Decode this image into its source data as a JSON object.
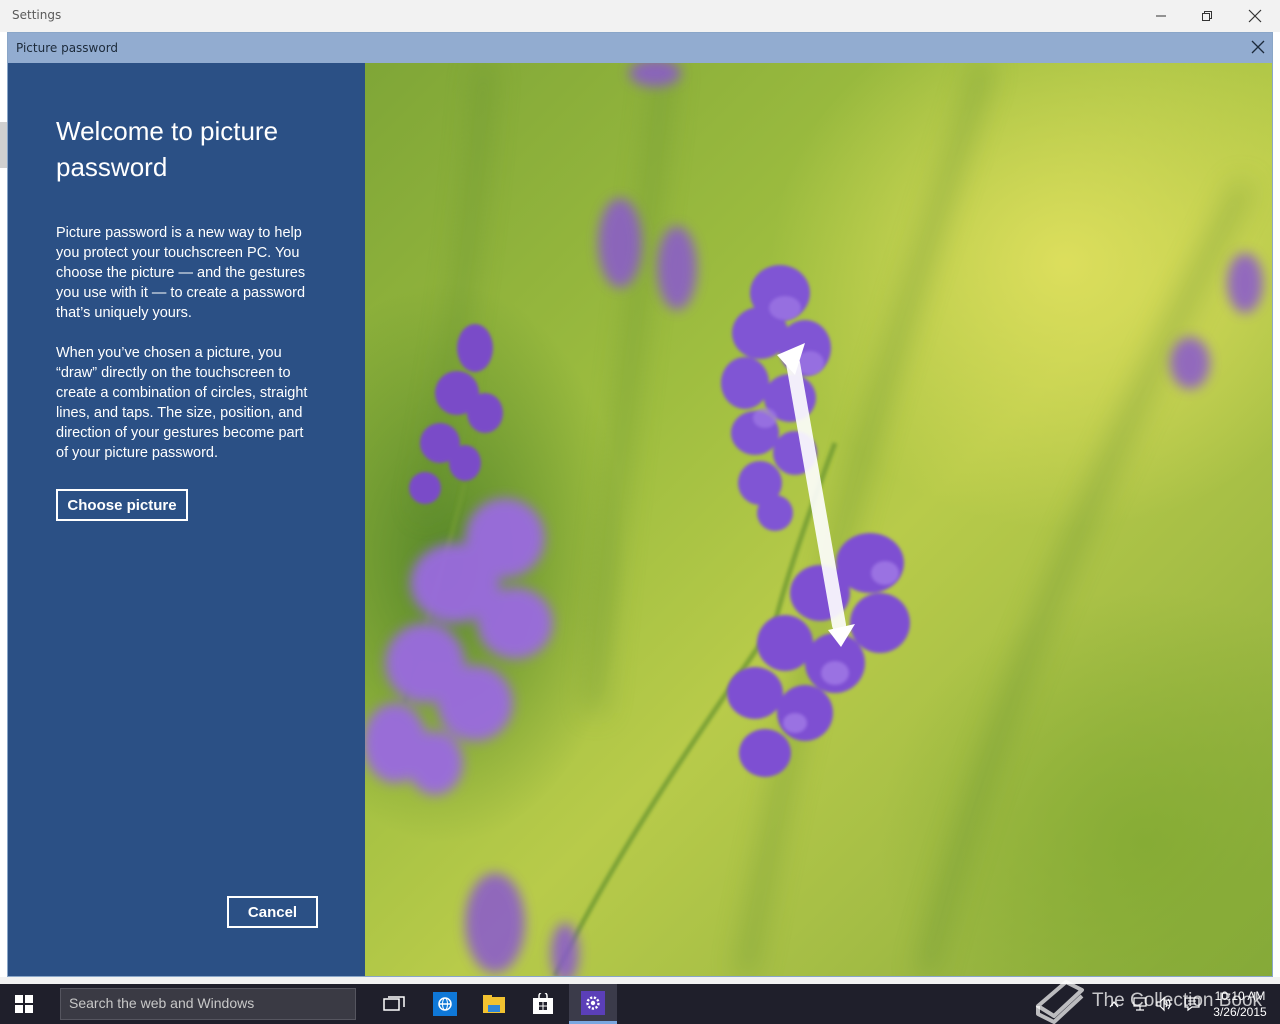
{
  "window": {
    "title": "Settings"
  },
  "dialog": {
    "title": "Picture password",
    "heading": "Welcome to picture password",
    "paragraph1": "Picture password is a new way to help you protect your touchscreen PC. You choose the picture — and the gestures you use with it — to create a password that’s uniquely yours.",
    "paragraph2": "When you’ve chosen a picture, you “draw” directly on the touchscreen to create a combination of circles, straight lines, and taps. The size, position, and direction of your gestures become part of your picture password.",
    "choose_label": "Choose picture",
    "cancel_label": "Cancel"
  },
  "taskbar": {
    "search_placeholder": "Search the web and Windows",
    "apps": [
      "task-view-icon",
      "internet-explorer-icon",
      "file-explorer-icon",
      "store-icon",
      "settings-icon"
    ],
    "clock_time": "10:10 AM",
    "clock_date": "3/26/2015"
  },
  "watermark": "The Collection Book",
  "colors": {
    "dialog_blue": "#2b5085",
    "dialog_titlebar": "#92acd0",
    "taskbar": "#1f1f2b"
  }
}
